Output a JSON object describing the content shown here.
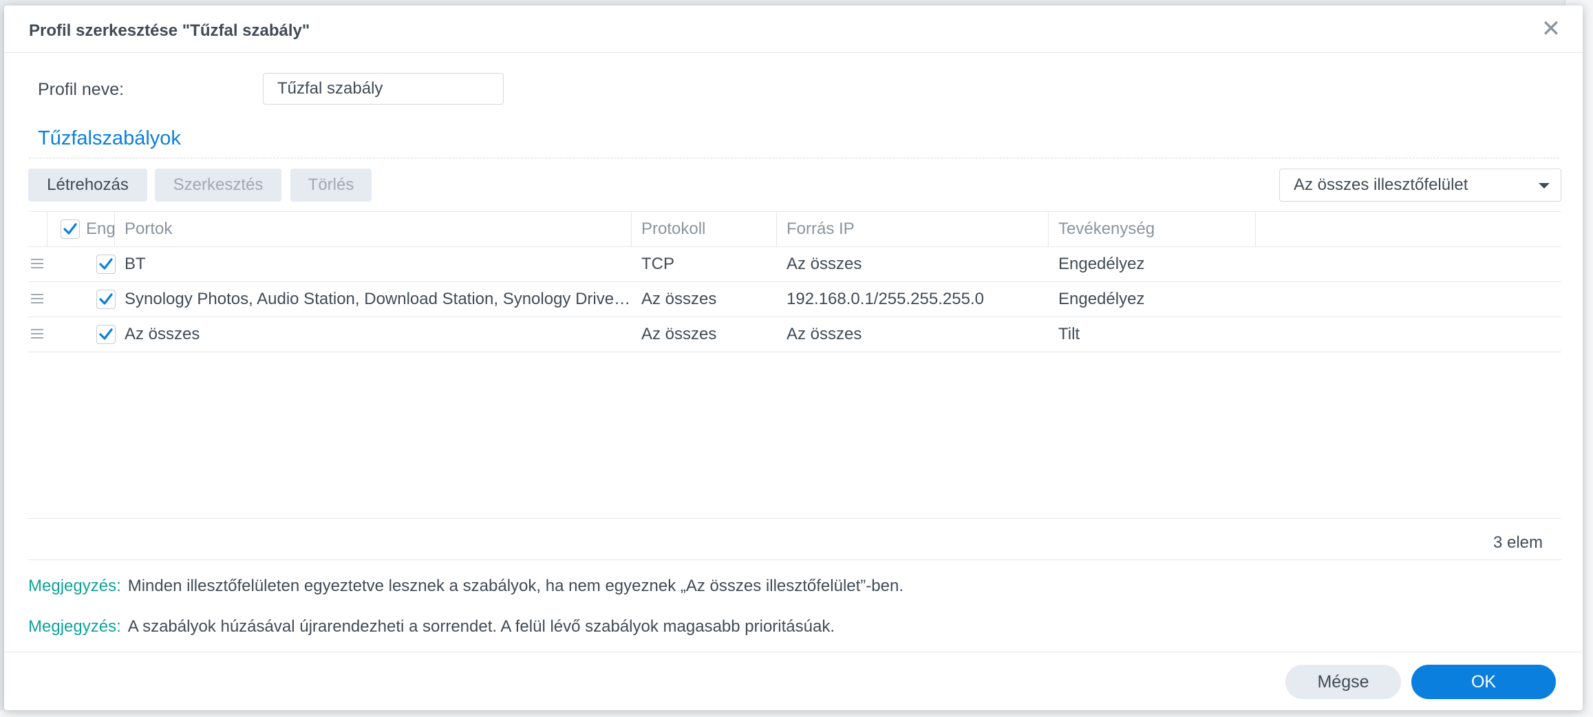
{
  "dialog": {
    "title": "Profil szerkesztése \"Tűzfal szabály\"",
    "close_glyph": "✕"
  },
  "profile": {
    "label": "Profil neve:",
    "value": "Tűzfal szabály"
  },
  "section": {
    "title": "Tűzfalszabályok"
  },
  "toolbar": {
    "create_label": "Létrehozás",
    "edit_label": "Szerkesztés",
    "delete_label": "Törlés",
    "interface_select_value": "Az összes illesztőfelület"
  },
  "grid": {
    "columns": {
      "enabled": "Enge...",
      "ports": "Portok",
      "protocol": "Protokoll",
      "source_ip": "Forrás IP",
      "action": "Tevékenység"
    },
    "header_checked": true,
    "rows": [
      {
        "enabled": true,
        "ports": "BT",
        "protocol": "TCP",
        "source_ip": "Az összes",
        "action": "Engedélyez"
      },
      {
        "enabled": true,
        "ports": "Synology Photos, Audio Station, Download Station, Synology Drive, Video Station, Video St...",
        "protocol": "Az összes",
        "source_ip": "192.168.0.1/255.255.255.0",
        "action": "Engedélyez"
      },
      {
        "enabled": true,
        "ports": "Az összes",
        "protocol": "Az összes",
        "source_ip": "Az összes",
        "action": "Tilt"
      }
    ],
    "count": "3 elem"
  },
  "notes": [
    {
      "label": "Megjegyzés:",
      "text": "Minden illesztőfelületen egyeztetve lesznek a szabályok, ha nem egyeznek „Az összes illesztőfelület”-ben."
    },
    {
      "label": "Megjegyzés:",
      "text": "A szabályok húzásával újrarendezheti a sorrendet. A felül lévő szabályok magasabb prioritásúak."
    }
  ],
  "footer": {
    "cancel_label": "Mégse",
    "ok_label": "OK"
  },
  "colors": {
    "accent": "#0a7fde",
    "note_label": "#0fa39d",
    "text": "#414b55",
    "muted": "#8a949e"
  },
  "icons": [
    "close-icon",
    "checkbox-checked-icon",
    "drag-handle-icon",
    "dropdown-caret-icon"
  ]
}
